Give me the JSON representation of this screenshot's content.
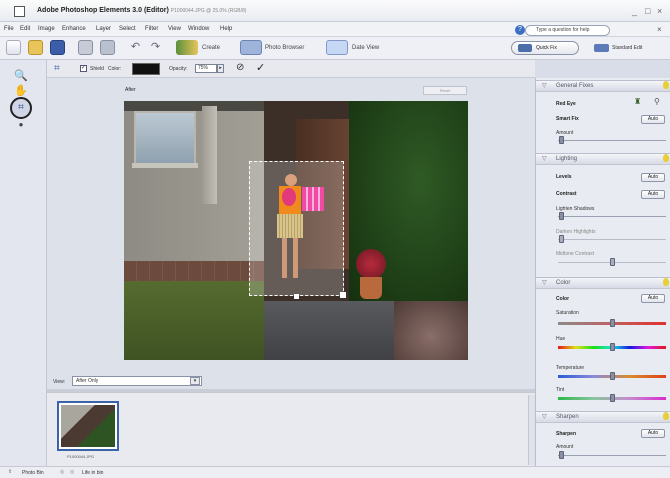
{
  "window": {
    "title": "Adobe Photoshop Elements 3.0 (Editor)",
    "doc": "P1000044.JPG @ 25.0% (RGB/8)"
  },
  "menu": [
    "File",
    "Edit",
    "Image",
    "Enhance",
    "Layer",
    "Select",
    "Filter",
    "View",
    "Window",
    "Help"
  ],
  "help": {
    "placeholder": "Type a question for help"
  },
  "toolbar": {
    "create": "Create",
    "photo_browser": "Photo Browser",
    "date_view": "Date View",
    "quick_fix": "Quick Fix",
    "standard_edit": "Standard Edit"
  },
  "options": {
    "shield": "Shield",
    "color": "Color:",
    "opacity_label": "Opacity:",
    "opacity_value": "75%"
  },
  "canvas": {
    "after_label": "After",
    "reset": "Reset"
  },
  "view": {
    "label": "View:",
    "selected": "After Only"
  },
  "photobin": {
    "filename": "P1000044.JPG"
  },
  "status": {
    "photo_bin": "Photo Bin",
    "life_in_bin": "Life in bin"
  },
  "palette": {
    "general_fixes": "General Fixes",
    "red_eye": "Red Eye",
    "smart_fix": "Smart Fix",
    "amount": "Amount",
    "auto": "Auto",
    "lighting": "Lighting",
    "levels": "Levels",
    "contrast": "Contrast",
    "lighten_shadows": "Lighten Shadows",
    "darken_highlights": "Darken Highlights",
    "midtone_contrast": "Midtone Contrast",
    "color_section": "Color",
    "color": "Color",
    "saturation": "Saturation",
    "hue": "Hue",
    "temperature": "Temperature",
    "tint": "Tint",
    "sharpen_section": "Sharpen",
    "sharpen": "Sharpen",
    "sharpen_amount": "Amount"
  }
}
